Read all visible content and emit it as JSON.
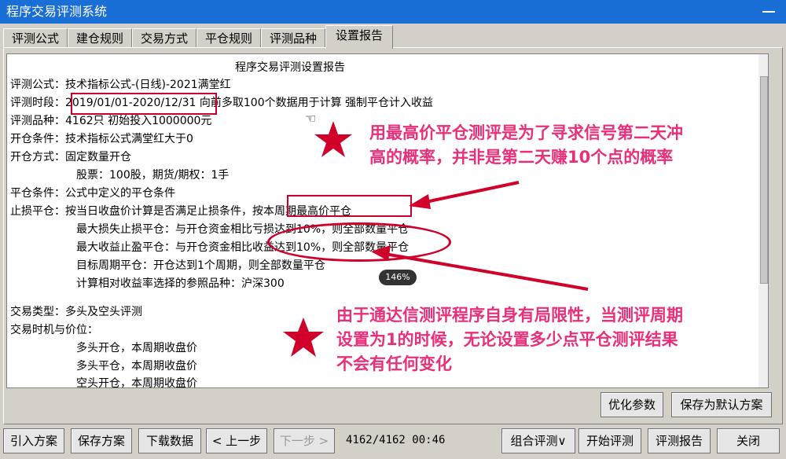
{
  "window": {
    "title": "程序交易评测系统"
  },
  "tabs": [
    {
      "label": "评测公式"
    },
    {
      "label": "建仓规则"
    },
    {
      "label": "交易方式"
    },
    {
      "label": "平仓规则"
    },
    {
      "label": "评测品种"
    },
    {
      "label": "设置报告"
    }
  ],
  "report": {
    "heading": "程序交易评测设置报告",
    "lines": [
      "评测公式：技术指标公式-(日线)-2021满堂红",
      "评测时段：2019/01/01-2020/12/31 向前多取100个数据用于计算 强制平仓计入收益",
      "评测品种：4162只  初始投入1000000元",
      "开仓条件：技术指标公式满堂红大于0",
      "开仓方式：固定数量开仓",
      "股票：100股，期货/期权：1手",
      "平仓条件：公式中定义的平仓条件",
      "止损平仓：按当日收盘价计算是否满足止损条件，按本周期最高价平仓",
      "最大损失止损平仓：与开仓资金相比亏损达到10%，则全部数量平仓",
      "最大收益止盈平仓：与开仓资金相比收益达到10%，则全部数量平仓",
      "目标周期平仓：开仓达到1个周期，则全部数量平仓",
      "计算相对收益率选择的参照品种：沪深300",
      "交易类型：多头及空头评测",
      "交易时机与价位：",
      "多头开仓，本周期收盘价",
      "多头平仓，本周期收盘价",
      "空头开仓，本周期收盘价"
    ]
  },
  "buttons": {
    "optimize": "优化参数",
    "save_default": "保存为默认方案",
    "import": "引入方案",
    "save": "保存方案",
    "download": "下载数据",
    "prev": "< 上一步",
    "next": "下一步 >",
    "combo": "组合评测∨",
    "start": "开始评测",
    "report": "评测报告",
    "close": "关闭"
  },
  "status": {
    "progress": "4162/4162 00:46"
  },
  "zoom": "146%",
  "annotations": {
    "note1": [
      "用最高价平仓测评是为了寻求信号第二天冲",
      "高的概率，并非是第二天赚10个点的概率"
    ],
    "note2": [
      "由于通达信测评程序自身有局限性，当测评周期",
      "设置为1的时候，无论设置多少点平仓测评结果",
      "不会有任何变化"
    ]
  },
  "colors": {
    "titlebar": "#1a6fd6",
    "annotation_text": "#e8307a",
    "annotation_mark": "#d0002a"
  }
}
